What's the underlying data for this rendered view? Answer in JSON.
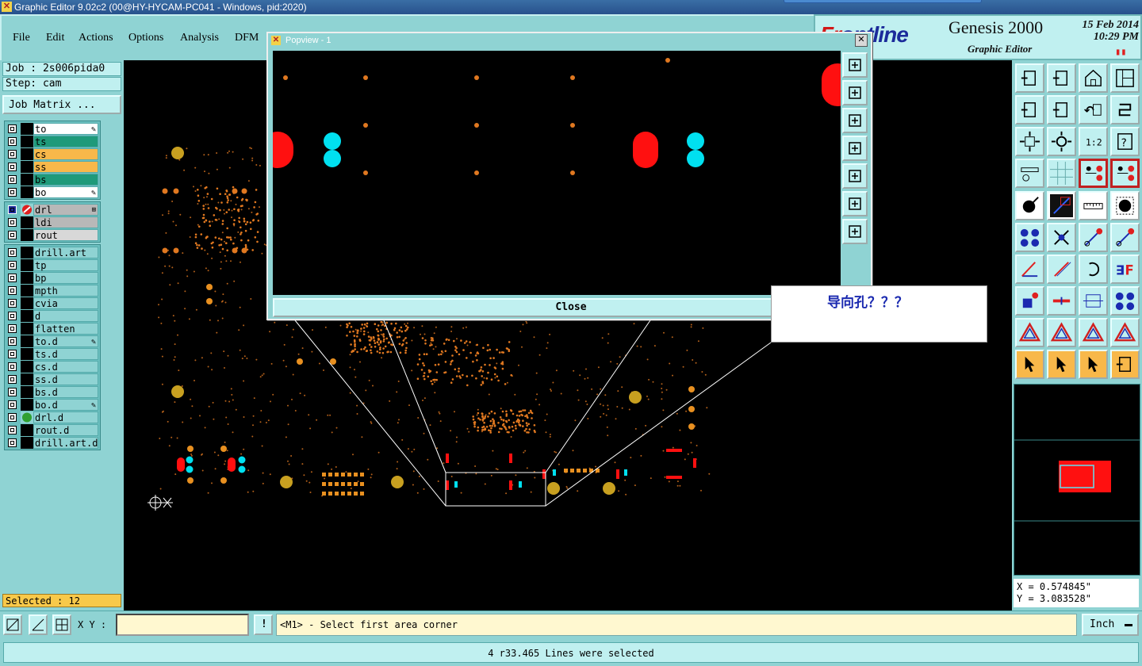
{
  "window": {
    "title": "Graphic Editor 9.02c2 (00@HY-HYCAM-PC041 - Windows, pid:2020)"
  },
  "menu": {
    "items": [
      "File",
      "Edit",
      "Actions",
      "Options",
      "Analysis",
      "DFM"
    ]
  },
  "brand": {
    "logo_red": "Fr",
    "logo_blue": "ontline",
    "product": "Genesis 2000",
    "subtitle": "Graphic Editor",
    "date": "15 Feb 2014",
    "time": "10:29 PM"
  },
  "job": {
    "job_label": "Job : 2s006pida0",
    "step_label": "Step: cam",
    "matrix_button": "Job Matrix ..."
  },
  "layers_board": [
    {
      "name": "to",
      "color": "#ffffff",
      "marker": "brush"
    },
    {
      "name": "ts",
      "color": "#1f9a7a"
    },
    {
      "name": "cs",
      "color": "#f8b84a"
    },
    {
      "name": "ss",
      "color": "#f8b84a"
    },
    {
      "name": "bs",
      "color": "#1f9a7a"
    },
    {
      "name": "bo",
      "color": "#ffffff",
      "marker": "brush"
    }
  ],
  "layers_drill": [
    {
      "name": "drl",
      "color": "#b8b8b8",
      "active": true
    },
    {
      "name": "ldi",
      "color": "#b8b8b8"
    },
    {
      "name": "rout",
      "color": "#d8d8d8"
    }
  ],
  "layers_misc": [
    {
      "name": "drill.art"
    },
    {
      "name": "tp"
    },
    {
      "name": "bp"
    },
    {
      "name": "mpth"
    },
    {
      "name": "cvia"
    },
    {
      "name": "d"
    },
    {
      "name": "flatten"
    },
    {
      "name": "to.d",
      "marker": "brush"
    },
    {
      "name": "ts.d"
    },
    {
      "name": "cs.d"
    },
    {
      "name": "ss.d"
    },
    {
      "name": "bs.d"
    },
    {
      "name": "bo.d",
      "marker": "brush"
    },
    {
      "name": "drl.d",
      "dot": true
    },
    {
      "name": "rout.d"
    },
    {
      "name": "drill.art.d"
    }
  ],
  "selection": {
    "label": "Selected : 12"
  },
  "popview": {
    "title": "Popview - 1",
    "close_label": "Close"
  },
  "annotation": {
    "text": "导向孔？？？"
  },
  "coords": {
    "x": "X = 0.574845\"",
    "y": "Y = 3.083528\""
  },
  "bottom": {
    "xy_label": "X Y :",
    "xy_value": "",
    "message": "<M1> - Select first area corner",
    "units": "Inch",
    "status": "4 r33.465 Lines were selected"
  },
  "colors": {
    "pad_orange": "#e07820",
    "pad_gold": "#c8a020",
    "pad_red": "#ff1010",
    "pad_cyan": "#00e0f0",
    "panel_cyan": "#8fd3d3",
    "highlight_yellow": "#f8c94a"
  }
}
